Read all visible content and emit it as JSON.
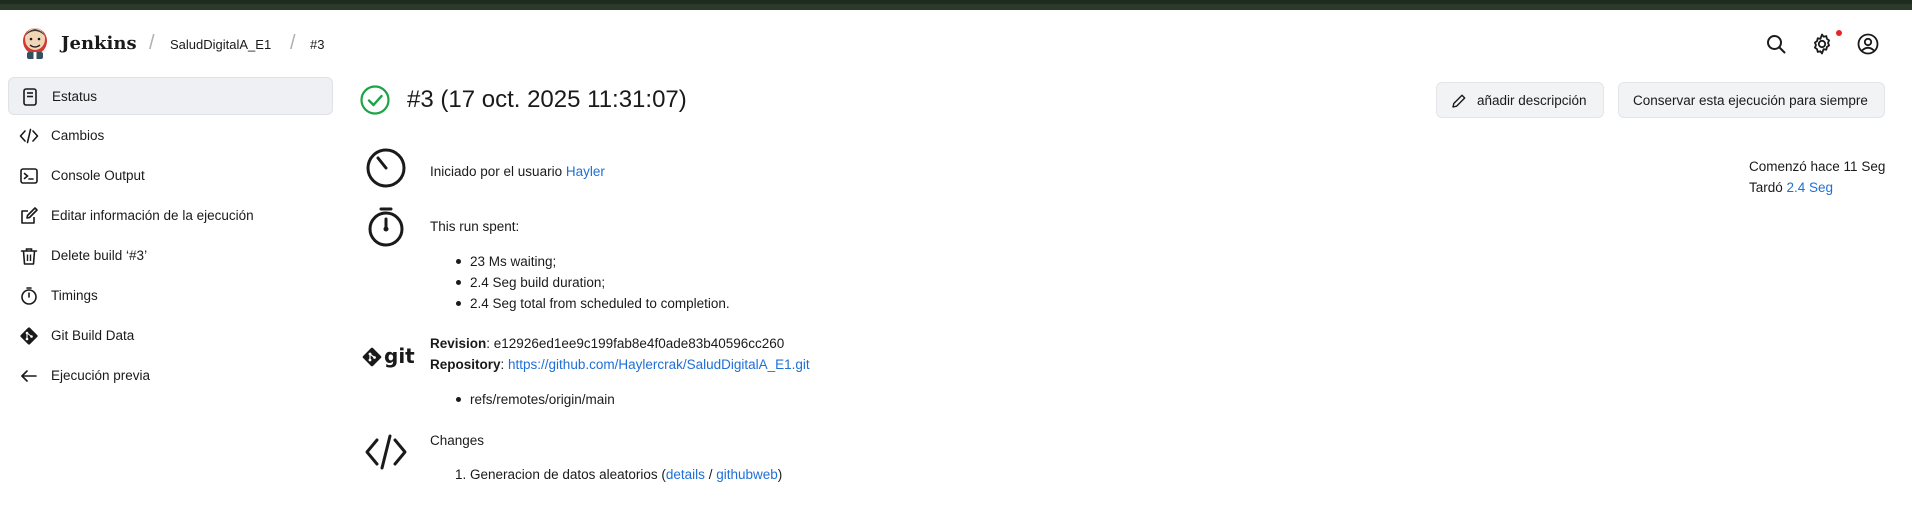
{
  "app": {
    "brand": "Jenkins"
  },
  "breadcrumb": {
    "project": "SaludDigitalA_E1",
    "build": "#3",
    "separator": "/"
  },
  "sidebar": {
    "items": [
      {
        "label": "Estatus",
        "icon": "document-icon",
        "active": true
      },
      {
        "label": "Cambios",
        "icon": "code-icon"
      },
      {
        "label": "Console Output",
        "icon": "terminal-icon"
      },
      {
        "label": "Editar información de la ejecución",
        "icon": "edit-icon"
      },
      {
        "label": "Delete build ‘#3’",
        "icon": "trash-icon"
      },
      {
        "label": "Timings",
        "icon": "stopwatch-icon"
      },
      {
        "label": "Git Build Data",
        "icon": "git-icon"
      },
      {
        "label": "Ejecución previa",
        "icon": "arrow-left-icon"
      }
    ]
  },
  "build": {
    "title": "#3 (17 oct. 2025 11:31:07)",
    "status_icon": "success-check-icon",
    "add_description_label": "añadir descripción",
    "keep_forever_label": "Conservar esta ejecución para siempre"
  },
  "summary": {
    "started_by_prefix": "Iniciado por el usuario ",
    "started_by_user": "Hayler",
    "started_ago": "Comenzó hace 11 Seg",
    "took_prefix": "Tardó ",
    "took_value": "2.4 Seg"
  },
  "timing": {
    "heading": "This run spent:",
    "items": [
      "23 Ms waiting;",
      "2.4 Seg build duration;",
      "2.4 Seg total from scheduled to completion."
    ]
  },
  "git": {
    "logo_text": "git",
    "revision_label": "Revision",
    "revision_value": ": e12926ed1ee9c199fab8e4f0ade83b40596cc260",
    "repository_label": "Repository",
    "repository_sep": ": ",
    "repository_url": "https://github.com/Haylercrak/SaludDigitalA_E1.git",
    "refs": [
      "refs/remotes/origin/main"
    ]
  },
  "changes": {
    "heading": "Changes",
    "items": [
      {
        "number": "1.",
        "text": "Generacion de datos aleatorios (",
        "details": "details",
        "slash": " / ",
        "githubweb": "githubweb",
        "close": ")"
      }
    ]
  }
}
